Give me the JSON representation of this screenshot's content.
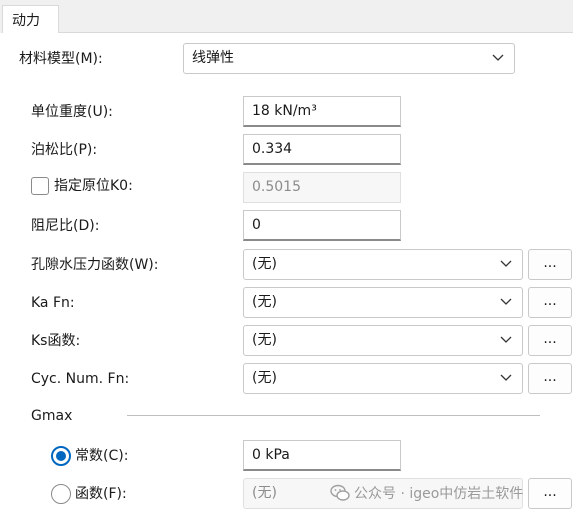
{
  "tab": {
    "label": "动力"
  },
  "material_model": {
    "label": "材料模型(M):",
    "value": "线弹性"
  },
  "fields": {
    "unit_weight": {
      "label": "单位重度(U):",
      "value": "18 kN/m³"
    },
    "poisson": {
      "label": "泊松比(P):",
      "value": "0.334"
    },
    "k0": {
      "label": "指定原位K0:",
      "value": "0.5015",
      "checked": false
    },
    "damping": {
      "label": "阻尼比(D):",
      "value": "0"
    }
  },
  "functions": {
    "pore_pressure": {
      "label": "孔隙水压力函数(W):",
      "value": "(无)",
      "button": "..."
    },
    "ka": {
      "label": "Ka Fn:",
      "value": "(无)",
      "button": "..."
    },
    "ks": {
      "label": "Ks函数:",
      "value": "(无)",
      "button": "..."
    },
    "cyc": {
      "label": "Cyc. Num. Fn:",
      "value": "(无)",
      "button": "..."
    }
  },
  "gmax": {
    "group_label": "Gmax",
    "constant": {
      "label": "常数(C):",
      "value": "0 kPa",
      "selected": true
    },
    "function": {
      "label": "函数(F):",
      "value": "(无)",
      "button": "...",
      "selected": false
    }
  },
  "watermark": {
    "text": "公众号 · igeo中仿岩土软件",
    "icon": "wechat-icon"
  },
  "colors": {
    "accent": "#0067c0",
    "border": "#c9c9c9",
    "tab_bar": "#f0f0f0"
  }
}
